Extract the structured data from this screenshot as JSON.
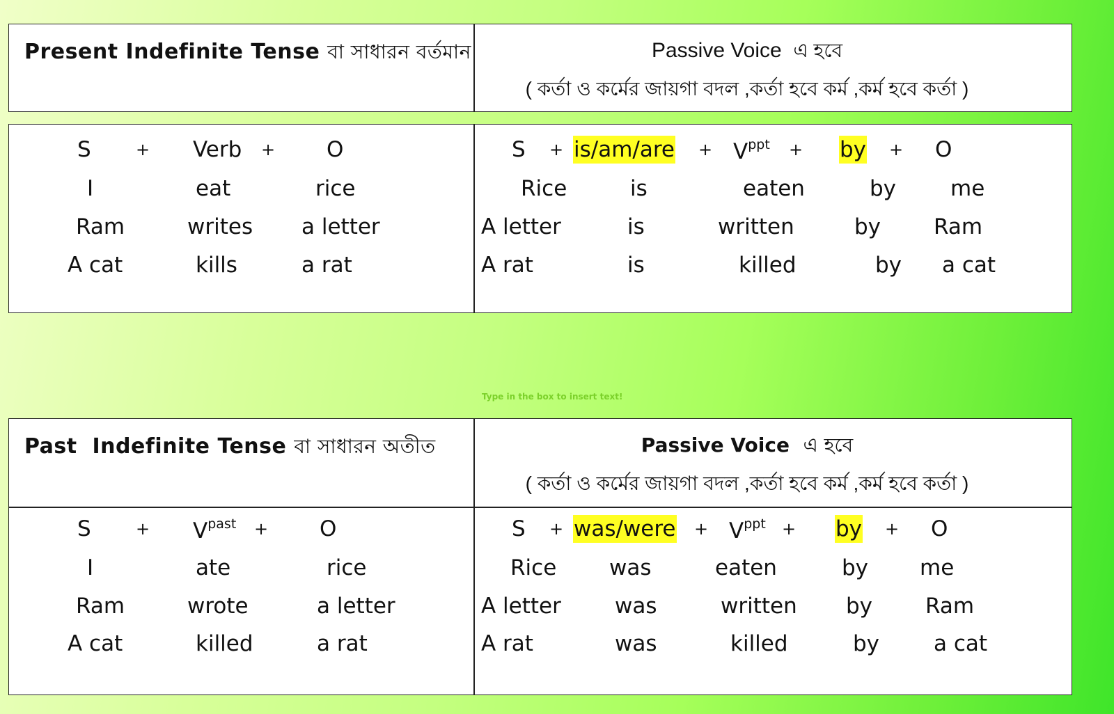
{
  "present": {
    "header": {
      "title": "Present Indefinite Tense",
      "title_bn": "বা সাধারন বর্তমান",
      "passive_title": "Passive Voice",
      "passive_title_bn": "এ হবে",
      "passive_note": "( কর্তা ও কর্মের জায়গা বদল ,কর্তা হবে কর্ম ,কর্ম হবে কর্তা )"
    },
    "active": {
      "formula": [
        "S",
        "+",
        "Verb",
        "+",
        "O"
      ],
      "rows": [
        [
          "I",
          "eat",
          "rice"
        ],
        [
          "Ram",
          "writes",
          "a letter"
        ],
        [
          "A cat",
          "kills",
          "a rat"
        ]
      ]
    },
    "passive": {
      "formula": {
        "s": "S",
        "plus": "+",
        "aux": "is/am/are",
        "v": "V",
        "v_sup": "ppt",
        "by": "by",
        "o": "O"
      },
      "rows": [
        [
          "Rice",
          "is",
          "eaten",
          "by",
          "me"
        ],
        [
          "A letter",
          "is",
          "written",
          "by",
          "Ram"
        ],
        [
          "A rat",
          "is",
          "killed",
          "by",
          "a cat"
        ]
      ]
    }
  },
  "hint": "Type in the box to insert text!",
  "past": {
    "header": {
      "title": "Past  Indefinite Tense",
      "title_bn": "বা সাধারন অতীত",
      "passive_title": "Passive Voice",
      "passive_title_bn": "এ হবে",
      "passive_note": "( কর্তা ও কর্মের জায়গা বদল ,কর্তা হবে কর্ম ,কর্ম হবে কর্তা )"
    },
    "active": {
      "formula": {
        "s": "S",
        "plus": "+",
        "v": "V",
        "v_sup": "past",
        "o": "O"
      },
      "rows": [
        [
          "I",
          "ate",
          "rice"
        ],
        [
          "Ram",
          "wrote",
          "a letter"
        ],
        [
          "A cat",
          "killed",
          "a rat"
        ]
      ]
    },
    "passive": {
      "formula": {
        "s": "S",
        "plus": "+",
        "aux": "was/were",
        "v": "V",
        "v_sup": "ppt",
        "by": "by",
        "o": "O"
      },
      "rows": [
        [
          "Rice",
          "was",
          "eaten",
          "by",
          "me"
        ],
        [
          "A letter",
          "was",
          "written",
          "by",
          "Ram"
        ],
        [
          "A rat",
          "was",
          "killed",
          "by",
          "a cat"
        ]
      ]
    }
  },
  "colors": {
    "highlight": "#ffff22",
    "hint": "#7bd12a"
  }
}
